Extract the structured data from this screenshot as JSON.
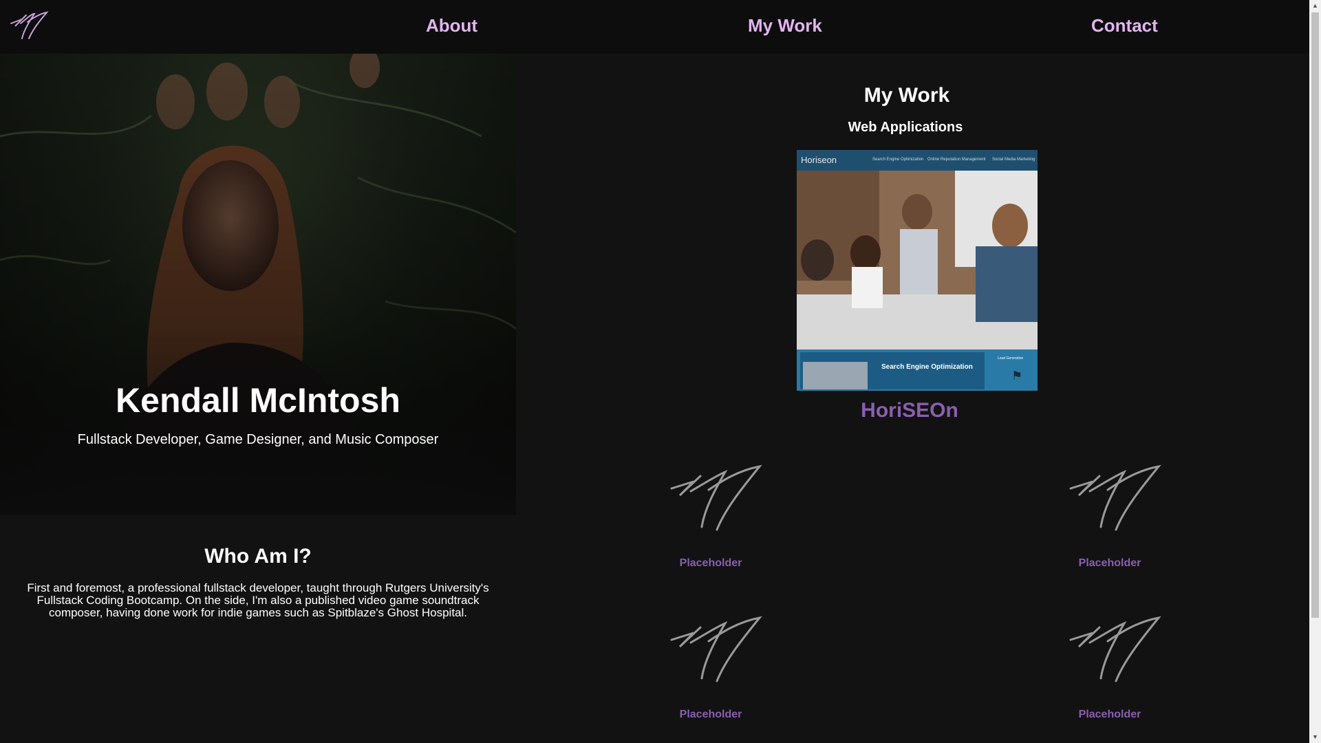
{
  "nav": {
    "logo": "kmc-signature-icon",
    "links": [
      "About",
      "My Work",
      "Contact"
    ]
  },
  "hero": {
    "name": "Kendall McIntosh",
    "tagline": "Fullstack Developer, Game Designer, and Music Composer"
  },
  "about": {
    "title": "Who Am I?",
    "text": "First and foremost, a professional fullstack developer, taught through Rutgers University's Fullstack Coding Bootcamp. On the side, I'm also a published video game soundtrack composer, having done work for indie games such as Spitblaze's Ghost Hospital."
  },
  "work": {
    "title": "My Work",
    "subtitle": "Web Applications",
    "featured": {
      "name": "HoriSEOn",
      "thumb": {
        "brand": "Horiseon",
        "nav": [
          "Search Engine Optimization",
          "Online Reputation Management",
          "Social Media Marketing"
        ],
        "section": "Search Engine Optimization",
        "side": "Lead Generation"
      }
    },
    "placeholders": [
      "Placeholder",
      "Placeholder",
      "Placeholder",
      "Placeholder"
    ]
  },
  "colors": {
    "accent": "#e2b4f0",
    "link": "#8a5fb0",
    "background": "#121212",
    "header": "#0d0d0d"
  }
}
